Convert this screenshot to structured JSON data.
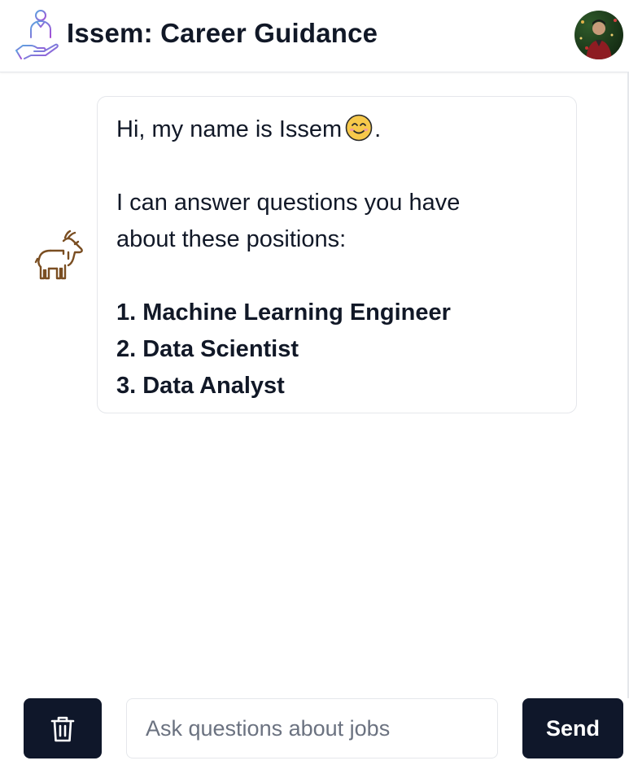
{
  "header": {
    "title": "Issem: Career Guidance",
    "logo_icon": "career-guidance-hand-icon",
    "avatar_icon": "user-avatar"
  },
  "chat": {
    "bot_avatar_icon": "goat-icon",
    "message": {
      "greeting": "Hi, my name is Issem",
      "greeting_suffix": ".",
      "emoji": "smiling-face-emoji",
      "intro_line1": "I can answer questions you have",
      "intro_line2": "about these positions:",
      "positions": [
        "1. Machine Learning Engineer",
        "2. Data Scientist",
        "3. Data Analyst"
      ]
    }
  },
  "composer": {
    "clear_icon": "trash-icon",
    "input_placeholder": "Ask questions about jobs",
    "input_value": "",
    "send_label": "Send"
  },
  "colors": {
    "primary_button": "#0f172a",
    "text": "#111827",
    "border": "#e5e7eb",
    "placeholder": "#6b7280",
    "goat_stroke": "#7a4e22"
  }
}
